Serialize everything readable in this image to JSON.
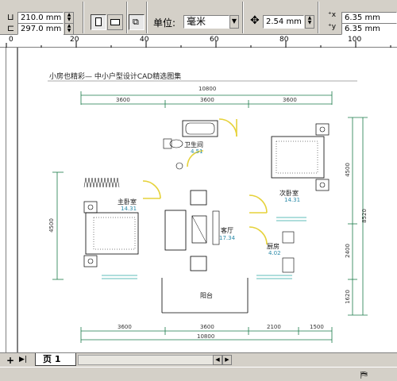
{
  "propbar": {
    "width_value": "210.0 mm",
    "height_value": "297.0 mm",
    "units_label": "单位:",
    "units_value": "毫米",
    "nudge_value": "2.54 mm",
    "dup_x_value": "6.35 mm",
    "dup_y_value": "6.35 mm"
  },
  "ruler": {
    "ticks": [
      "0",
      "20",
      "40",
      "60",
      "80",
      "100"
    ]
  },
  "tabs": {
    "page_label": "页 1"
  },
  "drawing": {
    "title": "小房也精彩— 中小户型设计CAD精选图集",
    "top_total": "10800",
    "top_segments": [
      "3600",
      "3600",
      "3600"
    ],
    "bottom_segments": [
      "3600",
      "3600",
      "2100",
      "1500"
    ],
    "bottom_total": "10800",
    "left_dim": "4500",
    "right_dims": [
      "4500",
      "2400",
      "1620"
    ],
    "right_total": "8520",
    "rooms": [
      {
        "name": "卫生间",
        "area": "4.51"
      },
      {
        "name": "主卧室",
        "area": "14.31"
      },
      {
        "name": "次卧室",
        "area": "14.31"
      },
      {
        "name": "客厅",
        "area": "17.34"
      },
      {
        "name": "厨房",
        "area": "4.02"
      },
      {
        "name": "阳台",
        "area": ""
      }
    ]
  }
}
